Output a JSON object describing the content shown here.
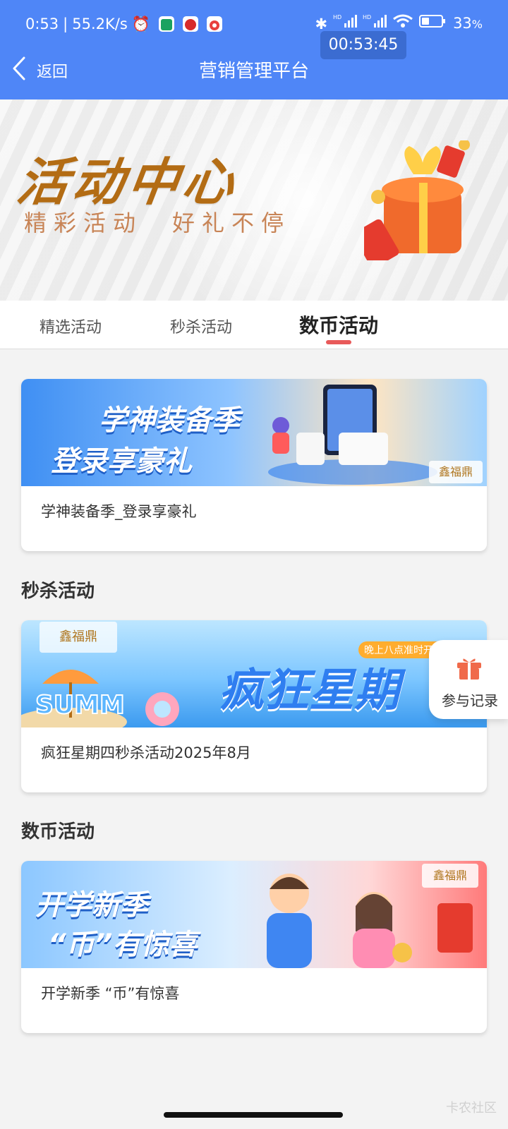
{
  "status_bar": {
    "time": "0:53",
    "speed": "55.2K/s",
    "battery": "33",
    "battery_unit": "%",
    "hd1": "HD",
    "hd2": "HD",
    "timer": "00:53:45",
    "colors": {
      "bg": "#4f86f7"
    }
  },
  "navbar": {
    "back_label": "返回",
    "title": "营销管理平台"
  },
  "hero": {
    "title": "活动中心",
    "subtitle": "精彩活动　好礼不停"
  },
  "tabs": [
    {
      "label": "精选活动",
      "active": false
    },
    {
      "label": "秒杀活动",
      "active": false
    },
    {
      "label": "数币活动",
      "active": true
    }
  ],
  "cards": [
    {
      "label": "学神装备季_登录享豪礼",
      "banner_text_1": "学神装备季",
      "banner_text_2": "登录享豪礼",
      "brand": "鑫福鼎"
    },
    {
      "section": "秒杀活动",
      "label": "疯狂星期四秒杀活动2025年8月",
      "banner_text": "疯狂星期",
      "banner_tag": "晚上八点准时开抢",
      "brand": "鑫福鼎"
    },
    {
      "section": "数币活动",
      "label": "开学新季 “币”有惊喜",
      "banner_text_1": "开学新季",
      "banner_text_2": "“币”有惊喜",
      "brand": "鑫福鼎"
    }
  ],
  "floating": {
    "label": "参与记录"
  },
  "watermark": "卡农社区"
}
